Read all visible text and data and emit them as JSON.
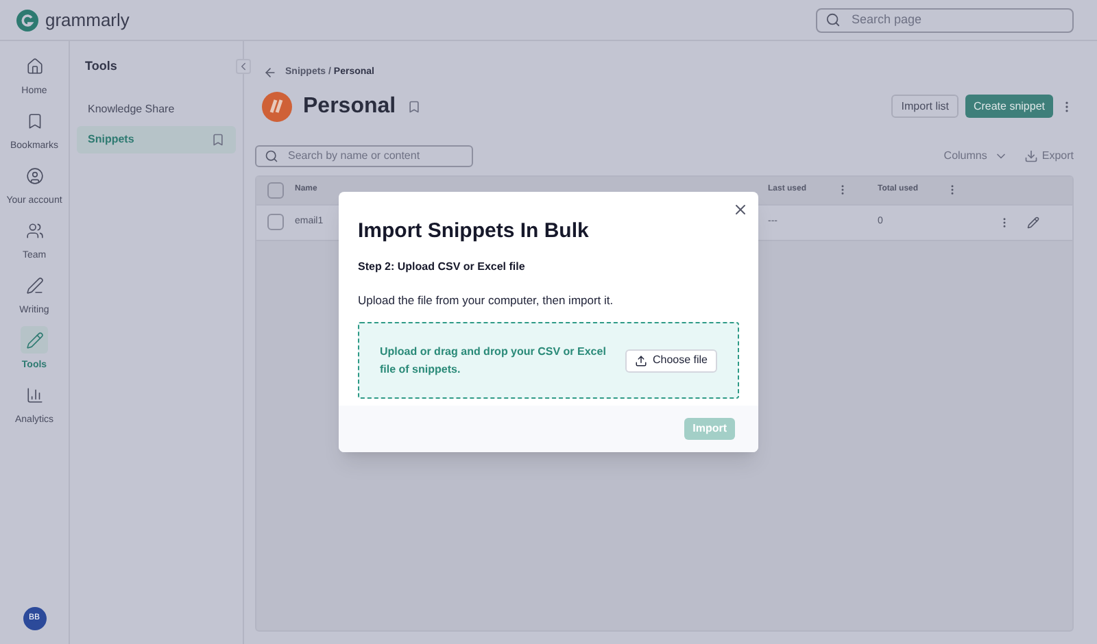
{
  "header": {
    "brand": "grammarly",
    "search": {
      "placeholder": "Search page"
    }
  },
  "nav": [
    {
      "label": "Home",
      "selected": false
    },
    {
      "label": "Bookmarks",
      "selected": false
    },
    {
      "label": "Your account",
      "selected": false
    },
    {
      "label": "Team",
      "selected": false
    },
    {
      "label": "Writing",
      "selected": false
    },
    {
      "label": "Tools",
      "selected": true
    },
    {
      "label": "Analytics",
      "selected": false
    }
  ],
  "avatar": "BB",
  "tools_panel": {
    "title": "Tools",
    "items": [
      {
        "label": "Knowledge Share",
        "selected": false,
        "bookmark": false
      },
      {
        "label": "Snippets",
        "selected": true,
        "bookmark": true
      }
    ]
  },
  "breadcrumb": {
    "parent": "Snippets",
    "separator": "/",
    "current": "Personal"
  },
  "page_title": "Personal",
  "actions": {
    "import": "Import list",
    "create": "Create snippet"
  },
  "search": {
    "placeholder": "Search by name or content"
  },
  "table_tools": {
    "columns": "Columns",
    "export": "Export"
  },
  "table": {
    "all_checked": false,
    "columns": [
      "Name",
      "Last used",
      "Total used"
    ],
    "rows": [
      {
        "checked": false,
        "cells": [
          "email1",
          "---",
          "0"
        ]
      }
    ]
  },
  "modal": {
    "title": "Import Snippets In Bulk",
    "step": "Step 2: Upload CSV or Excel file",
    "description": "Upload the file from your computer, then import it.",
    "dropzone": "Upload or drag and drop your CSV or Excel file of snippets.",
    "choose": "Choose file",
    "submit": {
      "label": "Import",
      "disabled": true
    }
  }
}
